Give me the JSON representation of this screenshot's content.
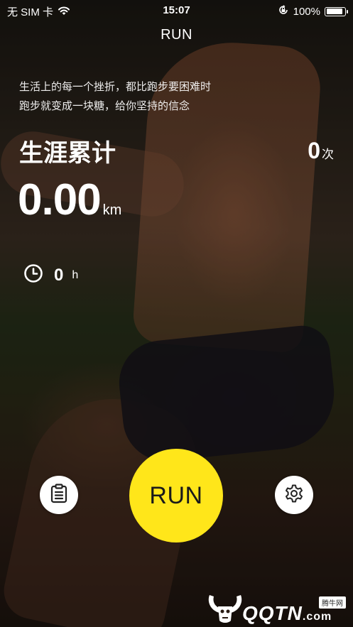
{
  "status_bar": {
    "carrier": "无 SIM 卡",
    "time": "15:07",
    "battery_percent": "100%",
    "battery_level": 1.0,
    "icons": [
      "wifi-icon",
      "orientation-lock-icon",
      "battery-icon"
    ]
  },
  "nav": {
    "title": "RUN"
  },
  "motto": {
    "line1": "生活上的每一个挫折，都比跑步要困难时",
    "line2": "跑步就变成一块糖，给你坚持的信念"
  },
  "stats": {
    "career_label": "生涯累计",
    "runs_value": "0",
    "runs_unit": "次",
    "distance_value": "0.00",
    "distance_unit": "km",
    "duration_value": "0",
    "duration_unit": "h"
  },
  "actions": {
    "run_label": "RUN",
    "history_icon": "clipboard-list-icon",
    "settings_icon": "gear-icon",
    "run_color": "#ffe61a"
  },
  "watermark": {
    "brand": "QQTN",
    "suffix": ".com",
    "badge": "腾牛网"
  }
}
